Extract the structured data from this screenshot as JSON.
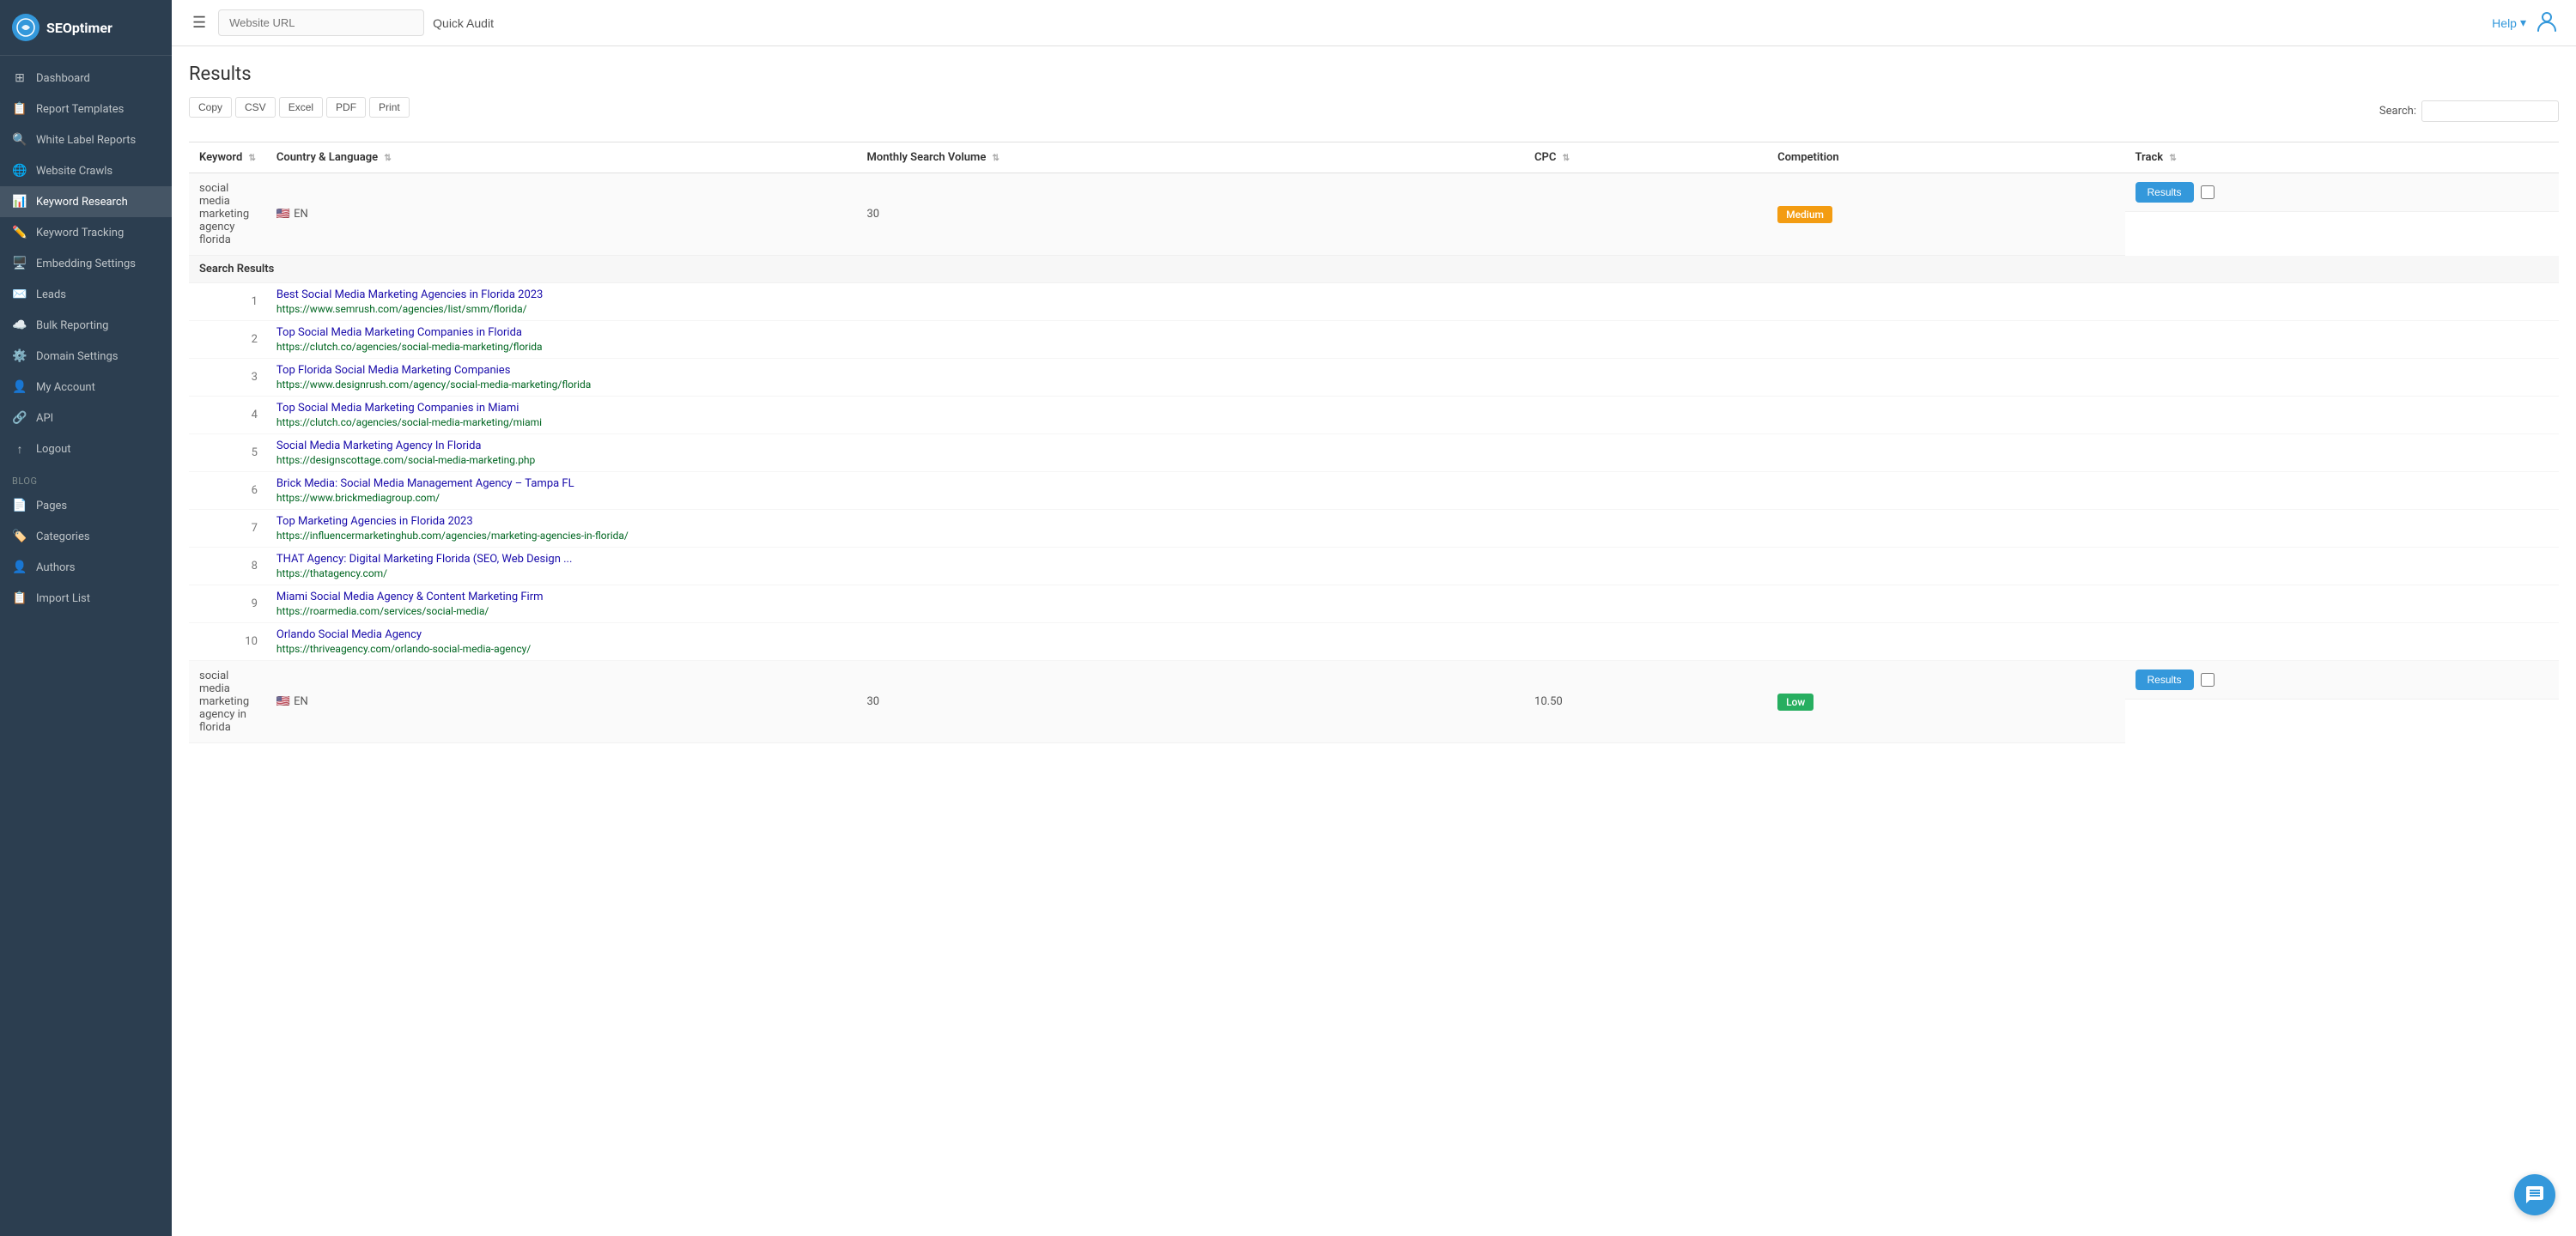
{
  "app": {
    "logo_text": "SEOptimer",
    "logo_abbr": "SE"
  },
  "header": {
    "url_placeholder": "Website URL",
    "quick_audit_label": "Quick Audit",
    "help_label": "Help",
    "help_arrow": "▾"
  },
  "sidebar": {
    "items": [
      {
        "id": "dashboard",
        "label": "Dashboard",
        "icon": "⊞",
        "active": false
      },
      {
        "id": "report-templates",
        "label": "Report Templates",
        "icon": "📋",
        "active": false
      },
      {
        "id": "white-label-reports",
        "label": "White Label Reports",
        "icon": "🔍",
        "active": false
      },
      {
        "id": "website-crawls",
        "label": "Website Crawls",
        "icon": "🌐",
        "active": false
      },
      {
        "id": "keyword-research",
        "label": "Keyword Research",
        "icon": "📊",
        "active": true
      },
      {
        "id": "keyword-tracking",
        "label": "Keyword Tracking",
        "icon": "✏️",
        "active": false
      },
      {
        "id": "embedding-settings",
        "label": "Embedding Settings",
        "icon": "🖥️",
        "active": false
      },
      {
        "id": "leads",
        "label": "Leads",
        "icon": "✉️",
        "active": false
      },
      {
        "id": "bulk-reporting",
        "label": "Bulk Reporting",
        "icon": "☁️",
        "active": false
      },
      {
        "id": "domain-settings",
        "label": "Domain Settings",
        "icon": "⚙️",
        "active": false
      },
      {
        "id": "my-account",
        "label": "My Account",
        "icon": "👤",
        "active": false
      },
      {
        "id": "api",
        "label": "API",
        "icon": "🔗",
        "active": false
      },
      {
        "id": "logout",
        "label": "Logout",
        "icon": "↑",
        "active": false
      }
    ],
    "blog_section_label": "Blog",
    "blog_items": [
      {
        "id": "pages",
        "label": "Pages",
        "icon": "📄"
      },
      {
        "id": "categories",
        "label": "Categories",
        "icon": "🏷️"
      },
      {
        "id": "authors",
        "label": "Authors",
        "icon": "👤"
      },
      {
        "id": "import-list",
        "label": "Import List",
        "icon": "📋"
      }
    ]
  },
  "main": {
    "results_title": "Results",
    "export_buttons": [
      "Copy",
      "CSV",
      "Excel",
      "PDF",
      "Print"
    ],
    "table_search_label": "Search:",
    "table_search_value": "",
    "columns": {
      "keyword": "Keyword",
      "country_language": "Country & Language",
      "monthly_search_volume": "Monthly Search Volume",
      "cpc": "CPC",
      "competition": "Competition",
      "track": "Track"
    },
    "keyword_rows": [
      {
        "keyword": "social media marketing agency florida",
        "country": "EN",
        "flag": "🇺🇸",
        "monthly_search_volume": "30",
        "cpc": "",
        "competition": "Medium",
        "competition_type": "medium",
        "has_results": true,
        "search_results": [
          {
            "num": 1,
            "title": "Best Social Media Marketing Agencies in Florida 2023",
            "url": "https://www.semrush.com/agencies/list/smm/florida/"
          },
          {
            "num": 2,
            "title": "Top Social Media Marketing Companies in Florida",
            "url": "https://clutch.co/agencies/social-media-marketing/florida"
          },
          {
            "num": 3,
            "title": "Top Florida Social Media Marketing Companies",
            "url": "https://www.designrush.com/agency/social-media-marketing/florida"
          },
          {
            "num": 4,
            "title": "Top Social Media Marketing Companies in Miami",
            "url": "https://clutch.co/agencies/social-media-marketing/miami"
          },
          {
            "num": 5,
            "title": "Social Media Marketing Agency In Florida",
            "url": "https://designscottage.com/social-media-marketing.php"
          },
          {
            "num": 6,
            "title": "Brick Media: Social Media Management Agency – Tampa FL",
            "url": "https://www.brickmediagroup.com/"
          },
          {
            "num": 7,
            "title": "Top Marketing Agencies in Florida 2023",
            "url": "https://influencermarketinghub.com/agencies/marketing-agencies-in-florida/"
          },
          {
            "num": 8,
            "title": "THAT Agency: Digital Marketing Florida (SEO, Web Design ...",
            "url": "https://thatagency.com/"
          },
          {
            "num": 9,
            "title": "Miami Social Media Agency & Content Marketing Firm",
            "url": "https://roarmedia.com/services/social-media/"
          },
          {
            "num": 10,
            "title": "Orlando Social Media Agency",
            "url": "https://thriveagency.com/orlando-social-media-agency/"
          }
        ]
      },
      {
        "keyword": "social media marketing agency in florida",
        "country": "EN",
        "flag": "🇺🇸",
        "monthly_search_volume": "30",
        "cpc": "10.50",
        "competition": "Low",
        "competition_type": "low",
        "has_results": true,
        "search_results": []
      }
    ]
  }
}
